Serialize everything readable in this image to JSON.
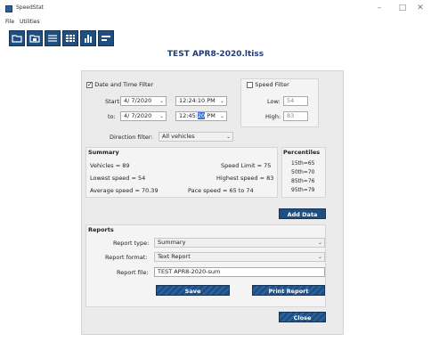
{
  "window": {
    "title": "SpeedStat"
  },
  "menu": {
    "file": "File",
    "utilities": "Utilities"
  },
  "toolbar_icons": [
    "open-folder-icon",
    "save-folder-icon",
    "list-view-icon",
    "grid-view-icon",
    "bar-chart-icon",
    "summary-icon"
  ],
  "file_title": "TEST APR8-2020.ltiss",
  "date_filter": {
    "label": "Date and Time Filter",
    "checked": true,
    "start_label": "Start:",
    "start_date": "4/ 7/2020",
    "start_time": "12:24:10 PM",
    "to_label": "to:",
    "to_date": "4/ 7/2020",
    "to_time_prefix": "12:45:",
    "to_time_selected": "20",
    "to_time_suffix": " PM"
  },
  "speed_filter": {
    "label": "Speed Filter",
    "checked": false,
    "low_label": "Low:",
    "low_value": "54",
    "high_label": "High:",
    "high_value": "83"
  },
  "direction": {
    "label": "Direction filter:",
    "value": "All vehicles"
  },
  "summary": {
    "title": "Summary",
    "vehicles": "Vehicles = 89",
    "speed_limit": "Speed Limit = 75",
    "lowest": "Lowest speed = 54",
    "highest": "Highest speed = 83",
    "average": "Average speed = 70.39",
    "pace": "Pace speed = 65  to  74"
  },
  "percentiles": {
    "title": "Percentiles",
    "items": [
      "15th=65",
      "50th=70",
      "85th=76",
      "95th=79"
    ]
  },
  "add_data_label": "Add Data",
  "reports": {
    "title": "Reports",
    "type_label": "Report type:",
    "type_value": "Summary",
    "format_label": "Report format:",
    "format_value": "Text Report",
    "file_label": "Report file:",
    "file_value": "TEST APR8-2020-sum"
  },
  "buttons": {
    "save": "Save",
    "print": "Print Report",
    "close": "Close"
  },
  "colors": {
    "accent": "#1f4e80",
    "title_text": "#1e3a78"
  }
}
